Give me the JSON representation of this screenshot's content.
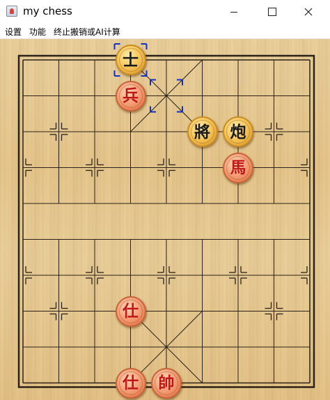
{
  "window": {
    "title": "my chess"
  },
  "menu": {
    "items": [
      "设置",
      "功能",
      "终止搬销或AI计算"
    ]
  },
  "colors": {
    "board": "#ecd19c",
    "grid_line": "#2a2218",
    "black_piece": "#f7c75b",
    "red_piece": "#e97b4f",
    "red_text": "#c01818",
    "selection": "#1030c8"
  },
  "board": {
    "files": 9,
    "ranks": 10,
    "pieces": [
      {
        "id": "black-advisor",
        "char": "士",
        "side": "black",
        "file": 3,
        "rank": 0
      },
      {
        "id": "black-general",
        "char": "將",
        "side": "black",
        "file": 5,
        "rank": 2
      },
      {
        "id": "black-cannon",
        "char": "炮",
        "side": "black",
        "file": 6,
        "rank": 2
      },
      {
        "id": "red-soldier",
        "char": "兵",
        "side": "red",
        "file": 3,
        "rank": 1
      },
      {
        "id": "red-horse",
        "char": "馬",
        "side": "red",
        "file": 6,
        "rank": 3
      },
      {
        "id": "red-advisor-1",
        "char": "仕",
        "side": "red",
        "file": 3,
        "rank": 7
      },
      {
        "id": "red-advisor-2",
        "char": "仕",
        "side": "red",
        "file": 3,
        "rank": 9
      },
      {
        "id": "red-king",
        "char": "帥",
        "side": "red",
        "file": 4,
        "rank": 9
      }
    ],
    "selection": {
      "from": {
        "file": 3,
        "rank": 0
      },
      "to": {
        "file": 4,
        "rank": 1
      }
    }
  }
}
